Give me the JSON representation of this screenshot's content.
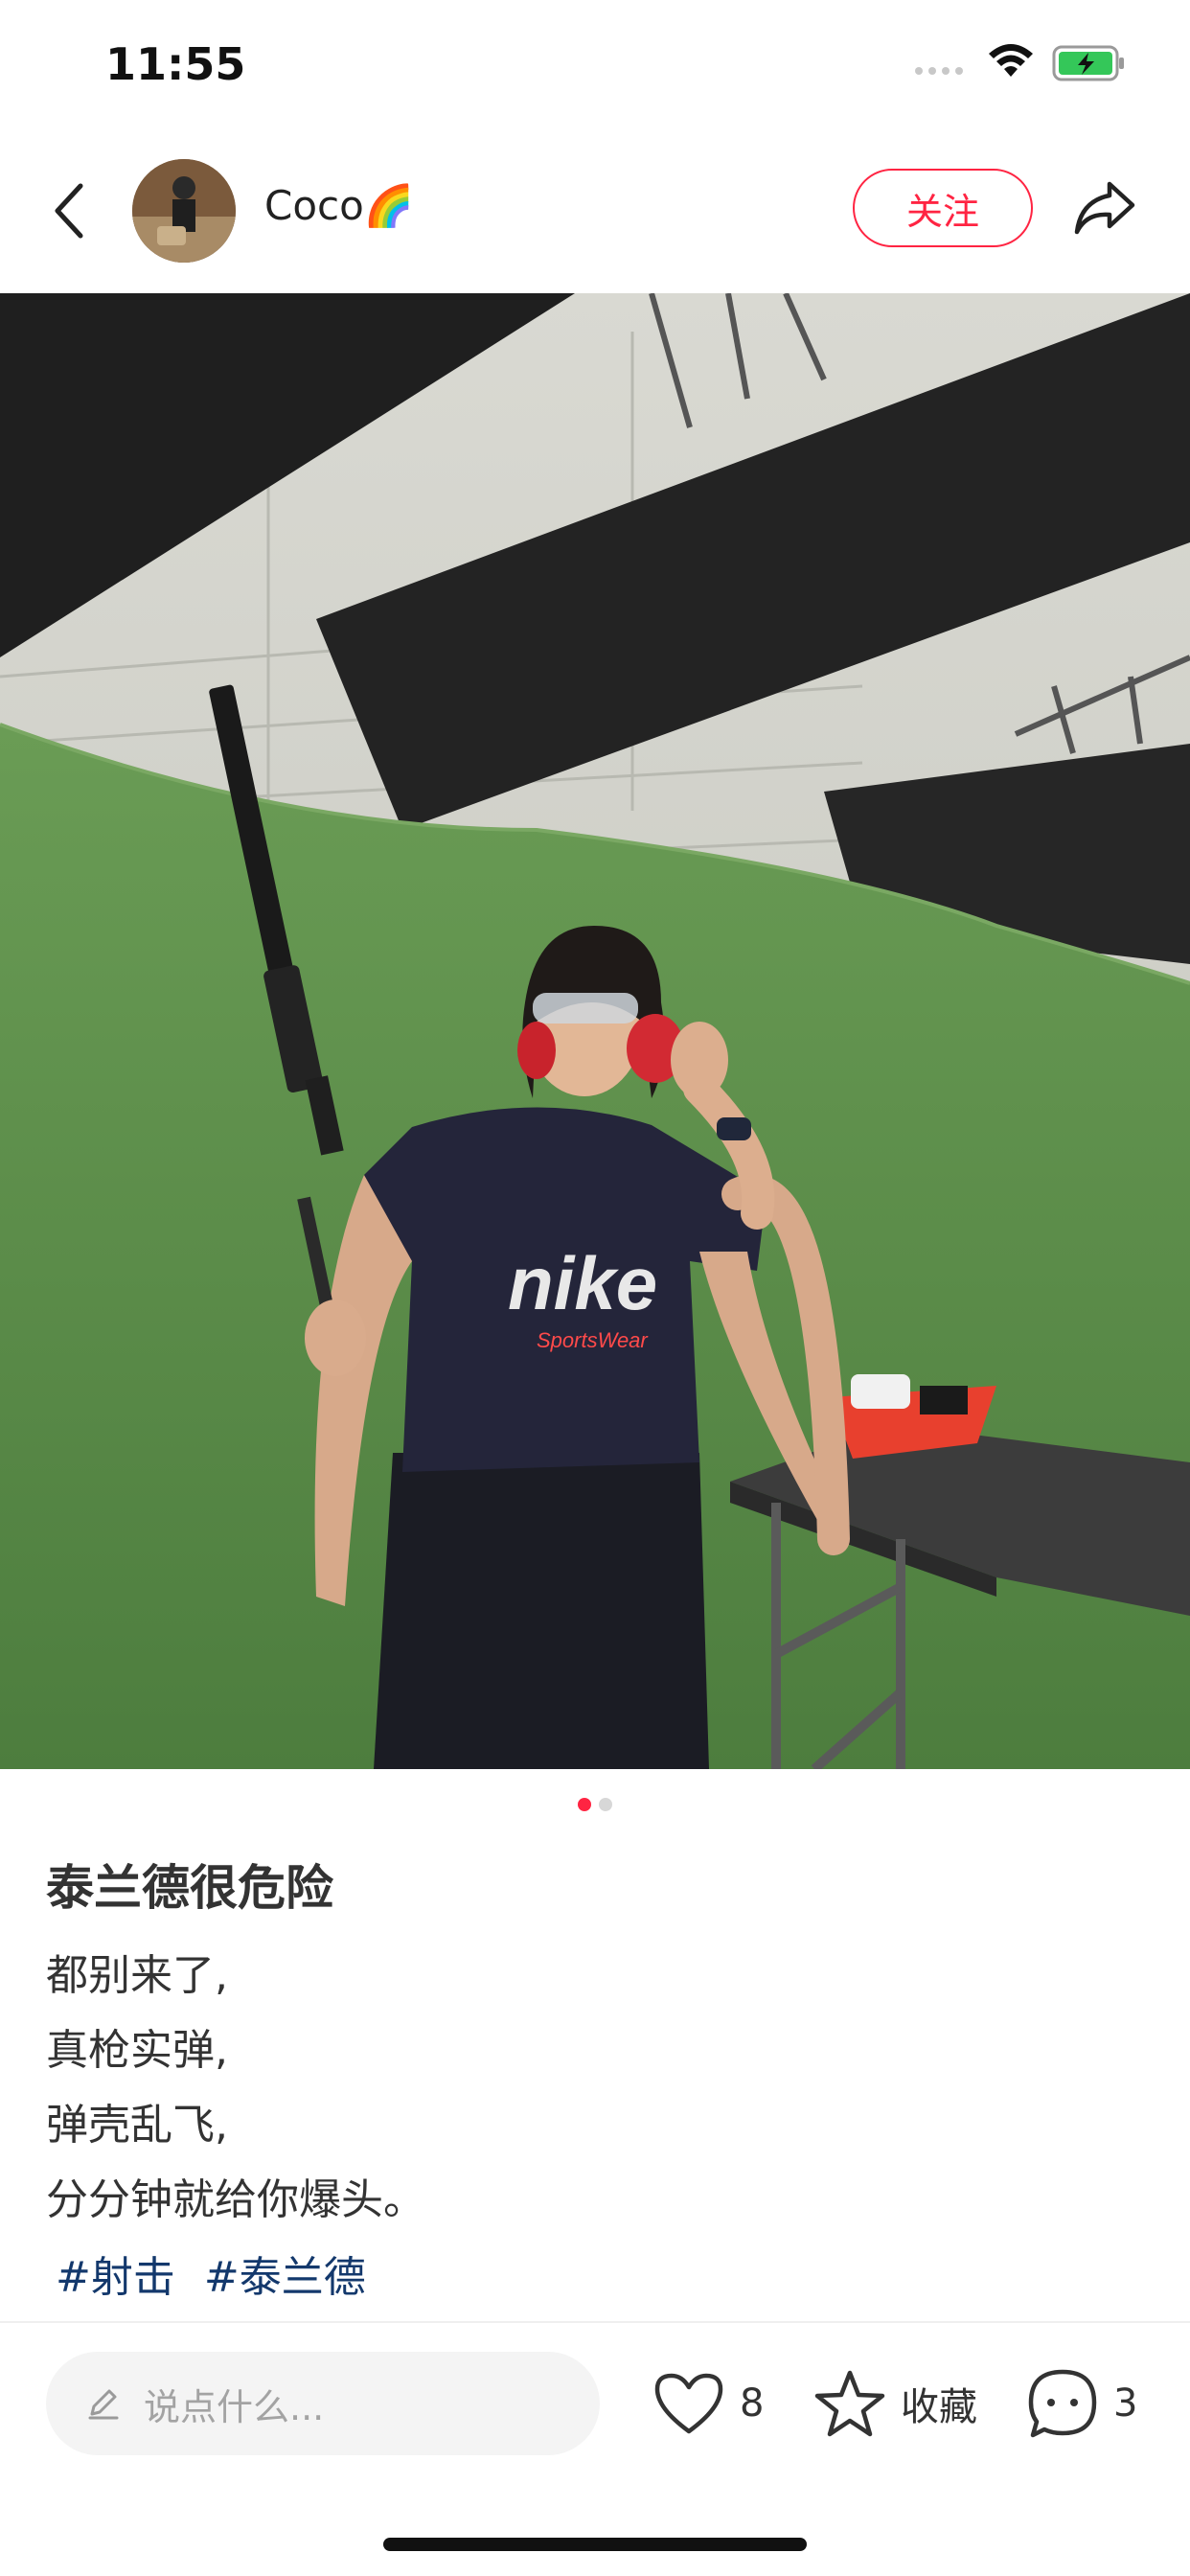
{
  "status_bar": {
    "time": "11:55"
  },
  "header": {
    "username": "Coco",
    "username_emoji": "🌈",
    "follow_label": "关注",
    "icons": [
      "chevron-left-icon",
      "share-icon"
    ]
  },
  "photo": {
    "indicator_count": 2,
    "active_index": 0,
    "shirt_text": "nike",
    "shirt_subtext": "SportsWear"
  },
  "post": {
    "title": "泰兰德很危险",
    "lines": [
      "都别来了,",
      "真枪实弹,",
      "弹壳乱飞,",
      "分分钟就给你爆头。"
    ],
    "tags": [
      "#射击",
      "#泰兰德"
    ]
  },
  "bottom_bar": {
    "comment_placeholder": "说点什么...",
    "like_count": "8",
    "collect_label": "收藏",
    "comment_count": "3"
  },
  "colors": {
    "accent": "#ff2442",
    "tag": "#13386c",
    "grass": "#5e8f4b"
  }
}
